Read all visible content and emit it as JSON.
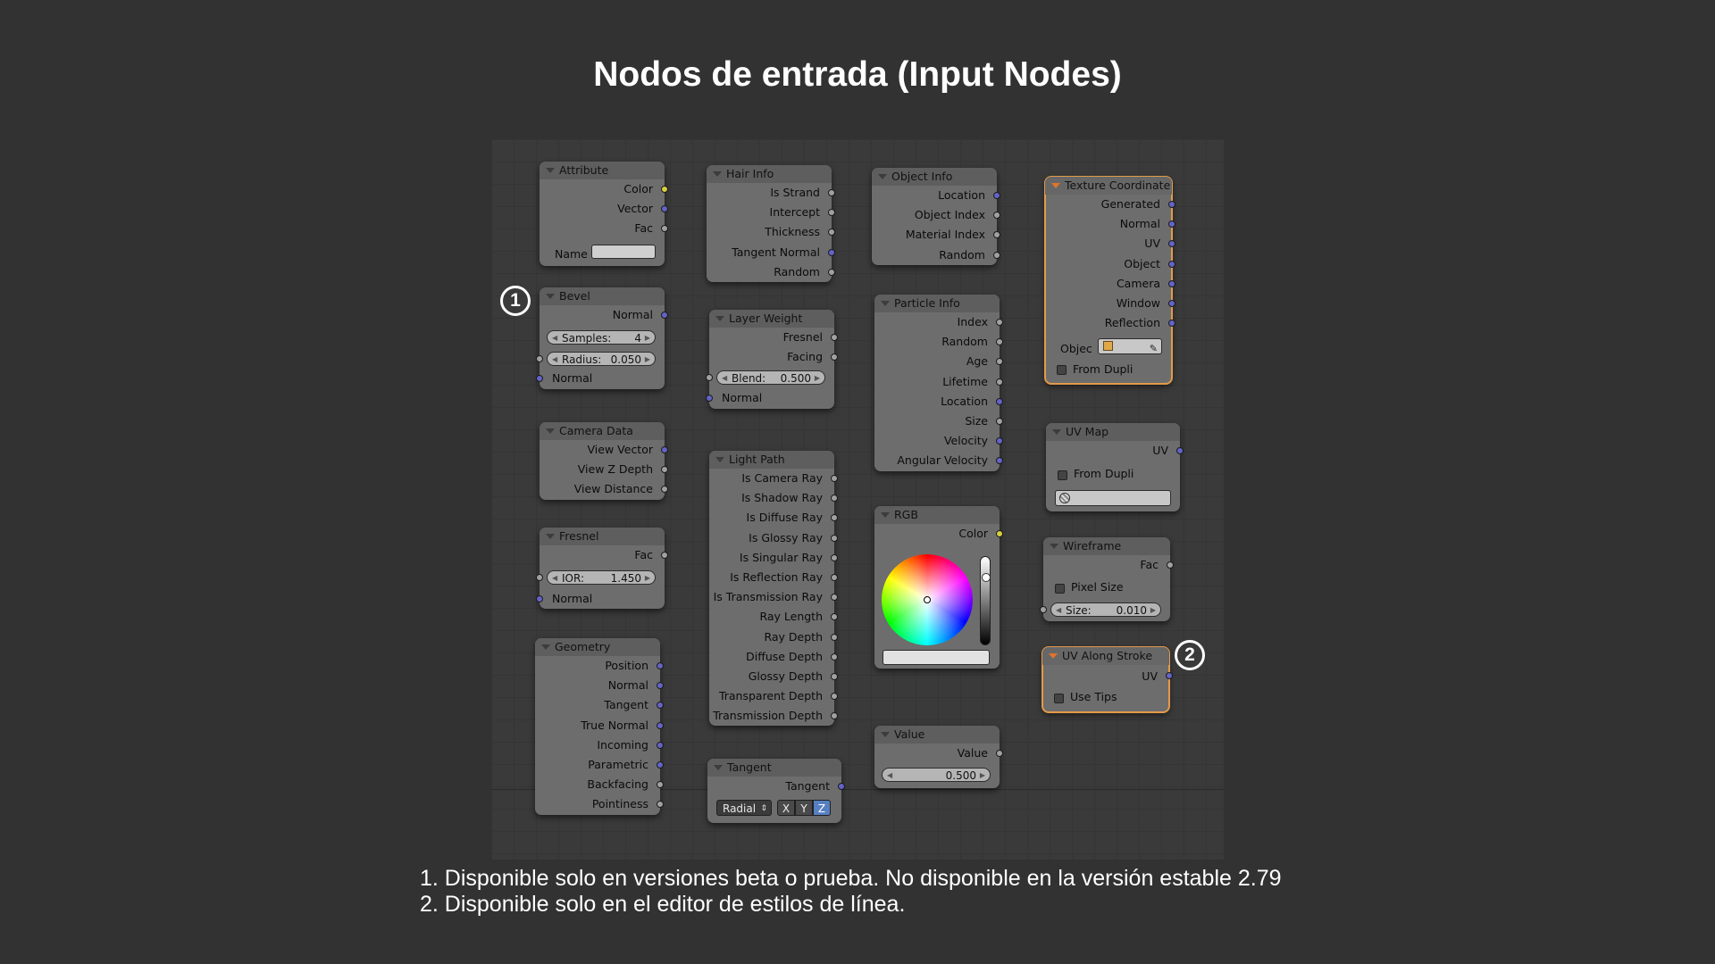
{
  "title": "Nodos de entrada (Input Nodes)",
  "badges": [
    "1",
    "2"
  ],
  "footnotes": [
    "1. Disponible solo en versiones beta o prueba. No disponible en la versión estable 2.79",
    "2. Disponible solo en el editor de estilos de línea."
  ],
  "colors": {
    "background": "#323232",
    "node_body": "#6d6d6d",
    "active_outline": "#e39a4a",
    "socket_color": "#d8d040",
    "socket_vector": "#6363c8",
    "socket_value": "#a1a1a1"
  },
  "nodes": {
    "attribute": {
      "title": "Attribute",
      "outputs": [
        "Color",
        "Vector",
        "Fac"
      ],
      "name_label": "Name"
    },
    "bevel": {
      "title": "Bevel",
      "outputs": [
        "Normal"
      ],
      "samples_label": "Samples:",
      "samples_value": "4",
      "radius_label": "Radius:",
      "radius_value": "0.050",
      "inputs": [
        "Normal"
      ]
    },
    "camera": {
      "title": "Camera Data",
      "outputs": [
        "View Vector",
        "View Z Depth",
        "View Distance"
      ]
    },
    "fresnel": {
      "title": "Fresnel",
      "outputs": [
        "Fac"
      ],
      "ior_label": "IOR:",
      "ior_value": "1.450",
      "inputs": [
        "Normal"
      ]
    },
    "geometry": {
      "title": "Geometry",
      "outputs": [
        "Position",
        "Normal",
        "Tangent",
        "True Normal",
        "Incoming",
        "Parametric",
        "Backfacing",
        "Pointiness"
      ]
    },
    "hair": {
      "title": "Hair Info",
      "outputs": [
        "Is Strand",
        "Intercept",
        "Thickness",
        "Tangent Normal",
        "Random"
      ]
    },
    "layerweight": {
      "title": "Layer Weight",
      "outputs": [
        "Fresnel",
        "Facing"
      ],
      "blend_label": "Blend:",
      "blend_value": "0.500",
      "inputs": [
        "Normal"
      ]
    },
    "lightpath": {
      "title": "Light Path",
      "outputs": [
        "Is Camera Ray",
        "Is Shadow Ray",
        "Is Diffuse Ray",
        "Is Glossy Ray",
        "Is Singular Ray",
        "Is Reflection Ray",
        "Is Transmission Ray",
        "Ray Length",
        "Ray Depth",
        "Diffuse Depth",
        "Glossy Depth",
        "Transparent Depth",
        "Transmission Depth"
      ]
    },
    "tangent": {
      "title": "Tangent",
      "outputs": [
        "Tangent"
      ],
      "mode": "Radial",
      "axes": [
        "X",
        "Y",
        "Z"
      ]
    },
    "objectinfo": {
      "title": "Object Info",
      "outputs": [
        "Location",
        "Object Index",
        "Material Index",
        "Random"
      ]
    },
    "particle": {
      "title": "Particle Info",
      "outputs": [
        "Index",
        "Random",
        "Age",
        "Lifetime",
        "Location",
        "Size",
        "Velocity",
        "Angular Velocity"
      ]
    },
    "rgb": {
      "title": "RGB",
      "outputs": [
        "Color"
      ]
    },
    "value": {
      "title": "Value",
      "outputs": [
        "Value"
      ],
      "value": "0.500"
    },
    "texcoord": {
      "title": "Texture Coordinate",
      "outputs": [
        "Generated",
        "Normal",
        "UV",
        "Object",
        "Camera",
        "Window",
        "Reflection"
      ],
      "object_label": "Objec",
      "from_dupli": "From Dupli"
    },
    "uvmap": {
      "title": "UV Map",
      "outputs": [
        "UV"
      ],
      "from_dupli": "From Dupli"
    },
    "wireframe": {
      "title": "Wireframe",
      "outputs": [
        "Fac"
      ],
      "pixel_size": "Pixel Size",
      "size_label": "Size:",
      "size_value": "0.010"
    },
    "uvstroke": {
      "title": "UV Along Stroke",
      "outputs": [
        "UV"
      ],
      "use_tips": "Use Tips"
    }
  }
}
